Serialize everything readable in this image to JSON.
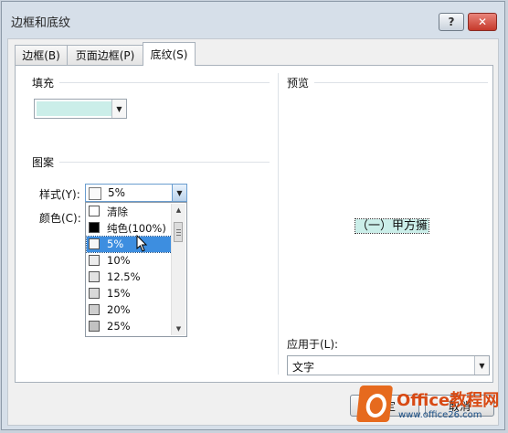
{
  "window": {
    "title": "边框和底纹"
  },
  "titlebar": {
    "help_glyph": "?",
    "close_glyph": "✕"
  },
  "tabs": [
    {
      "label": "边框(B)"
    },
    {
      "label": "页面边框(P)"
    },
    {
      "label": "底纹(S)",
      "active": true
    }
  ],
  "fill": {
    "section_label": "填充",
    "current_color": "#cbeee9"
  },
  "pattern": {
    "section_label": "图案",
    "style_label": "样式(Y):",
    "style_value": "5%",
    "color_label": "颜色(C):",
    "options": [
      {
        "label": "清除",
        "swatch": "#ffffff"
      },
      {
        "label": "纯色(100%)",
        "swatch": "#000000"
      },
      {
        "label": "5%",
        "swatch": "#f7f7f7",
        "selected": true
      },
      {
        "label": "10%",
        "swatch": "#ececec"
      },
      {
        "label": "12.5%",
        "swatch": "#e2e2e2"
      },
      {
        "label": "15%",
        "swatch": "#d9d9d9"
      },
      {
        "label": "20%",
        "swatch": "#cecece"
      },
      {
        "label": "25%",
        "swatch": "#c2c2c2"
      }
    ]
  },
  "preview": {
    "section_label": "预览",
    "sample_text": "（一）甲方擁",
    "apply_label": "应用于(L):",
    "apply_value": "文字"
  },
  "buttons": {
    "ok": "确定",
    "cancel": "取消"
  },
  "watermark": {
    "title": "Office教程网",
    "url": "www.office26.com"
  },
  "colors": {
    "accent": "#3d8ee0",
    "shading": "#cbeee9"
  }
}
